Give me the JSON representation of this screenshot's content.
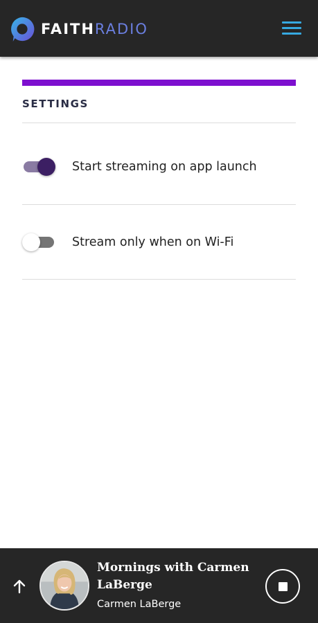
{
  "header": {
    "logo_word_1": "FAITH",
    "logo_word_2": "RADIO",
    "logo_icon": "speech-bubble-logo-icon",
    "menu_icon": "hamburger-menu-icon"
  },
  "colors": {
    "header_bg": "#262626",
    "accent_bar": "#7d0fcf",
    "menu_icon": "#36a9e1",
    "toggle_on_thumb": "#3c1f63",
    "toggle_on_track": "#8a7ba3",
    "toggle_off_track": "#757575",
    "player_bg": "#262626"
  },
  "settings": {
    "title": "SETTINGS",
    "items": [
      {
        "label": "Start streaming on app launch",
        "enabled": true
      },
      {
        "label": "Stream only when on Wi-Fi",
        "enabled": false
      }
    ]
  },
  "player": {
    "expand_icon": "arrow-up-icon",
    "show_title": "Mornings with Carmen LaBerge",
    "host": "Carmen LaBerge",
    "control_icon": "stop-icon",
    "state": "playing"
  }
}
